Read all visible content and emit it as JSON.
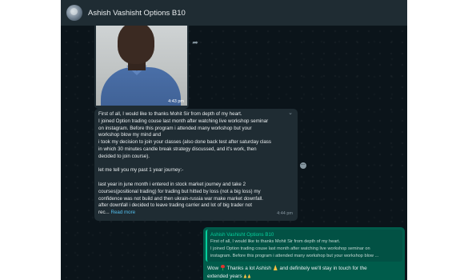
{
  "header": {
    "title": "Ashish Vashisht Options B10"
  },
  "image_message": {
    "time": "4:43 pm"
  },
  "text_message": {
    "paragraphs": [
      [
        "First of all, I would like to thanks Mohit Sir from depth of my heart.",
        "I joined Option trading couse last month after watching live workshop seminar",
        "on instagram. Before this program i attended many workshop but your",
        "workshop blow my mind and",
        "i took my decision to join your classes (also done back test after saturday class",
        "in which 30 minutes candle break strategy discussed, and it's work, then",
        "decided to join course)."
      ],
      [
        "let me tell you my past 1 year journey:-"
      ],
      [
        "last year in june month i entered in stock market journey and take 2",
        "courses(positional trading) for trading but hitted by loss (not a big loss) my",
        "confidence was not build and then ukrain-russia war make market downfall.",
        "after downfall i decided to leave trading carrier and lot of big trader not",
        "rec..."
      ]
    ],
    "read_more": "Read more",
    "time": "4:44 pm"
  },
  "reply_message": {
    "quote_name": "Ashish Vashisht Options B10",
    "quote_lines": [
      "First of all, I would like to thanks Mohit Sir from depth of my heart.",
      "I joined Option trading couse last month after watching live workshop seminar on",
      "instagram. Before this program i attended many workshop but your workshop blow ..."
    ],
    "text_part1": "Wow ",
    "text_part2": " Thanks a lot Ashish ",
    "text_part3": " and definitely we'll stay in touch for the",
    "text_part4": "extended years "
  },
  "colors": {
    "app_bg": "#0b141a",
    "header_bg": "#1f2c33",
    "incoming_bubble": "#1f2c33",
    "outgoing_bubble": "#005c4b",
    "quote_accent": "#06cf9c",
    "link": "#53bdeb"
  },
  "icons": [
    "forward-icon",
    "chevron-down-icon",
    "emoji-icon",
    "rose-emoji",
    "praying-hands-emoji"
  ]
}
